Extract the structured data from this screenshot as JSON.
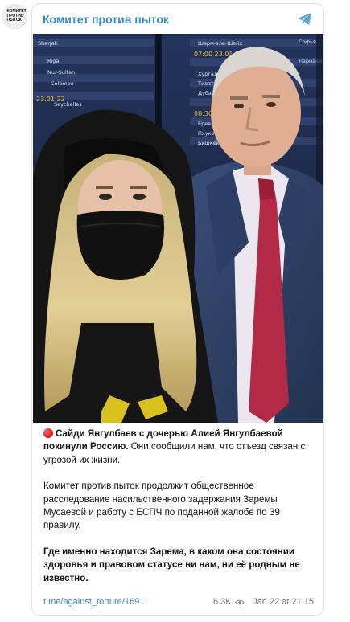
{
  "channel": {
    "name": "Комитет против пыток",
    "avatar_lines": [
      "КОМИТЕТ",
      "ПРОТИВ",
      "ПЫТОК"
    ]
  },
  "post": {
    "paragraph1_bold": "Сайди Янгулбаев с дочерью Алией Янгулбаевой покинули Россию.",
    "paragraph1_rest": " Они сообщили нам, что отъезд связан с угрозой их жизни.",
    "paragraph2": "Комитет против пыток продолжит общественное расследование насильственного задержания Заремы Мусаевой и работу с ЕСПЧ по поданной жалобе по 39 правилу.",
    "paragraph3_bold": "Где именно находится Зарема, в каком она состоянии здоровья и правовом статусе ни нам, ни её родным не известно."
  },
  "footer": {
    "link": "t.me/against_torture/1691",
    "views": "6.3K",
    "date": "Jan 22 at 21:15"
  },
  "photo": {
    "board_text": [
      "Sharjah",
      "Riga",
      "Nur-Sultan",
      "Colombo",
      "Seychelles",
      "23.01.22",
      "Шарм-эль-Шейх",
      "07:00 23.01.22",
      "Хургада",
      "Тиват",
      "Дубай",
      "08:30 23.01.22",
      "Ереван",
      "Пхукет",
      "Бишкек",
      "Софья",
      "Ларнака"
    ]
  },
  "colors": {
    "link": "#3a8cc4",
    "accent_dot": "#d31616",
    "board_bg": "#1b2b4f"
  }
}
